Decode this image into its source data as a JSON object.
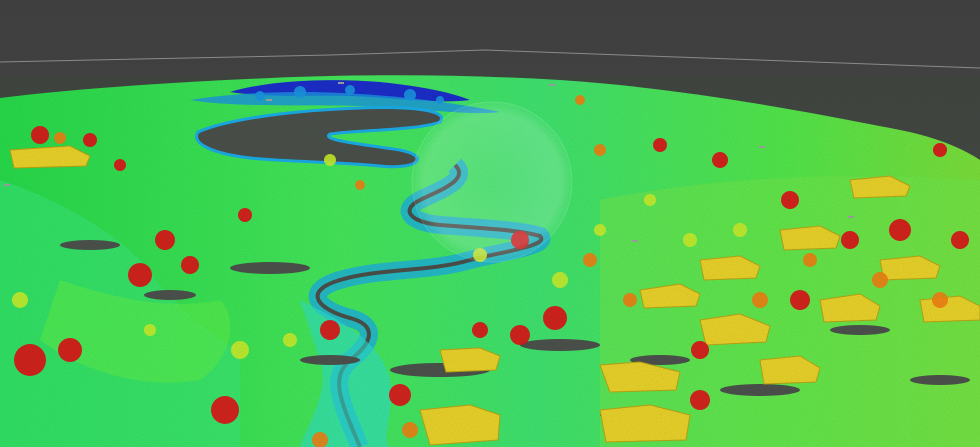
{
  "viewer": {
    "background_color": "#474747",
    "colormap": [
      "#1a22c8",
      "#1aa6e6",
      "#2fe0c8",
      "#2fd84a",
      "#c8e62a",
      "#f2d21a",
      "#f07a12",
      "#d8141a"
    ],
    "navigation_widget": "orbit-sphere"
  },
  "markers": [
    {
      "id": "m1",
      "text": ""
    },
    {
      "id": "m2",
      "text": ""
    },
    {
      "id": "m3",
      "text": ""
    },
    {
      "id": "m4",
      "text": ""
    },
    {
      "id": "m5",
      "text": ""
    },
    {
      "id": "m6",
      "text": ""
    },
    {
      "id": "m7",
      "text": ""
    }
  ],
  "status": {
    "corner_text": ""
  }
}
